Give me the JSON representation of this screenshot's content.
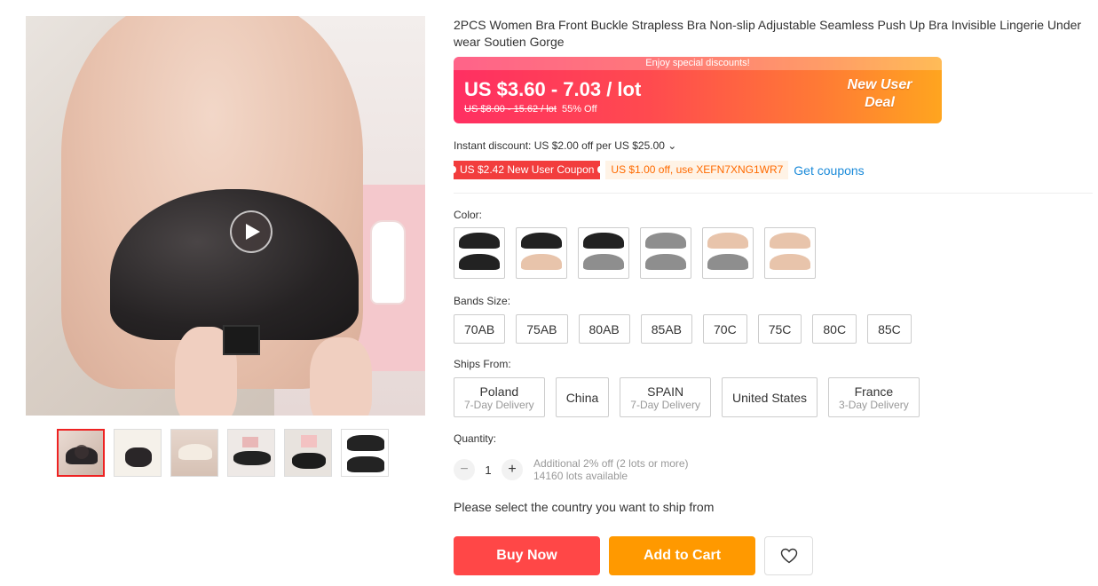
{
  "product": {
    "title": "2PCS Women Bra Front Buckle Strapless Bra Non-slip Adjustable Seamless Push Up Bra Invisible Lingerie Underwear Soutien Gorge"
  },
  "gallery": {
    "main_icon": "play-icon",
    "thumbnails": [
      "thumb-1",
      "thumb-2",
      "thumb-3",
      "thumb-4",
      "thumb-5",
      "thumb-6"
    ]
  },
  "price": {
    "discount_strip": "Enjoy special discounts!",
    "current": "US $3.60 - 7.03 / lot",
    "original": "US $8.00 - 15.62 / lot",
    "discount_pct": "55% Off",
    "deal_line1": "New User",
    "deal_line2": "Deal",
    "gradient_start": "#ff2f62",
    "gradient_end": "#ffa51f"
  },
  "instant_discount": "Instant discount: US $2.00 off per US $25.00 ⌄",
  "coupons": {
    "new_user": "US $2.42 New User Coupon",
    "code": "US $1.00 off, use XEFN7XNG1WR7",
    "get": "Get coupons"
  },
  "color": {
    "label": "Color:",
    "swatches": [
      {
        "top": "#222222",
        "bottom": "#222222"
      },
      {
        "top": "#222222",
        "bottom": "#e8c4ab"
      },
      {
        "top": "#222222",
        "bottom": "#8e8e8e"
      },
      {
        "top": "#8e8e8e",
        "bottom": "#8e8e8e"
      },
      {
        "top": "#e8c4ab",
        "bottom": "#8e8e8e"
      },
      {
        "top": "#e8c4ab",
        "bottom": "#e8c4ab"
      }
    ]
  },
  "bands": {
    "label": "Bands Size:",
    "options": [
      "70AB",
      "75AB",
      "80AB",
      "85AB",
      "70C",
      "75C",
      "80C",
      "85C"
    ]
  },
  "ships_from": {
    "label": "Ships From:",
    "options": [
      {
        "name": "Poland",
        "sub": "7-Day Delivery"
      },
      {
        "name": "China",
        "sub": ""
      },
      {
        "name": "SPAIN",
        "sub": "7-Day Delivery"
      },
      {
        "name": "United States",
        "sub": ""
      },
      {
        "name": "France",
        "sub": "3-Day Delivery"
      }
    ]
  },
  "quantity": {
    "label": "Quantity:",
    "minus": "−",
    "value": "1",
    "plus": "+",
    "info1": "Additional 2% off (2 lots or more)",
    "info2": "14160 lots available"
  },
  "select_country": "Please select the country you want to ship from",
  "actions": {
    "buy": "Buy Now",
    "cart": "Add to Cart",
    "wish_icon": "heart-icon"
  }
}
